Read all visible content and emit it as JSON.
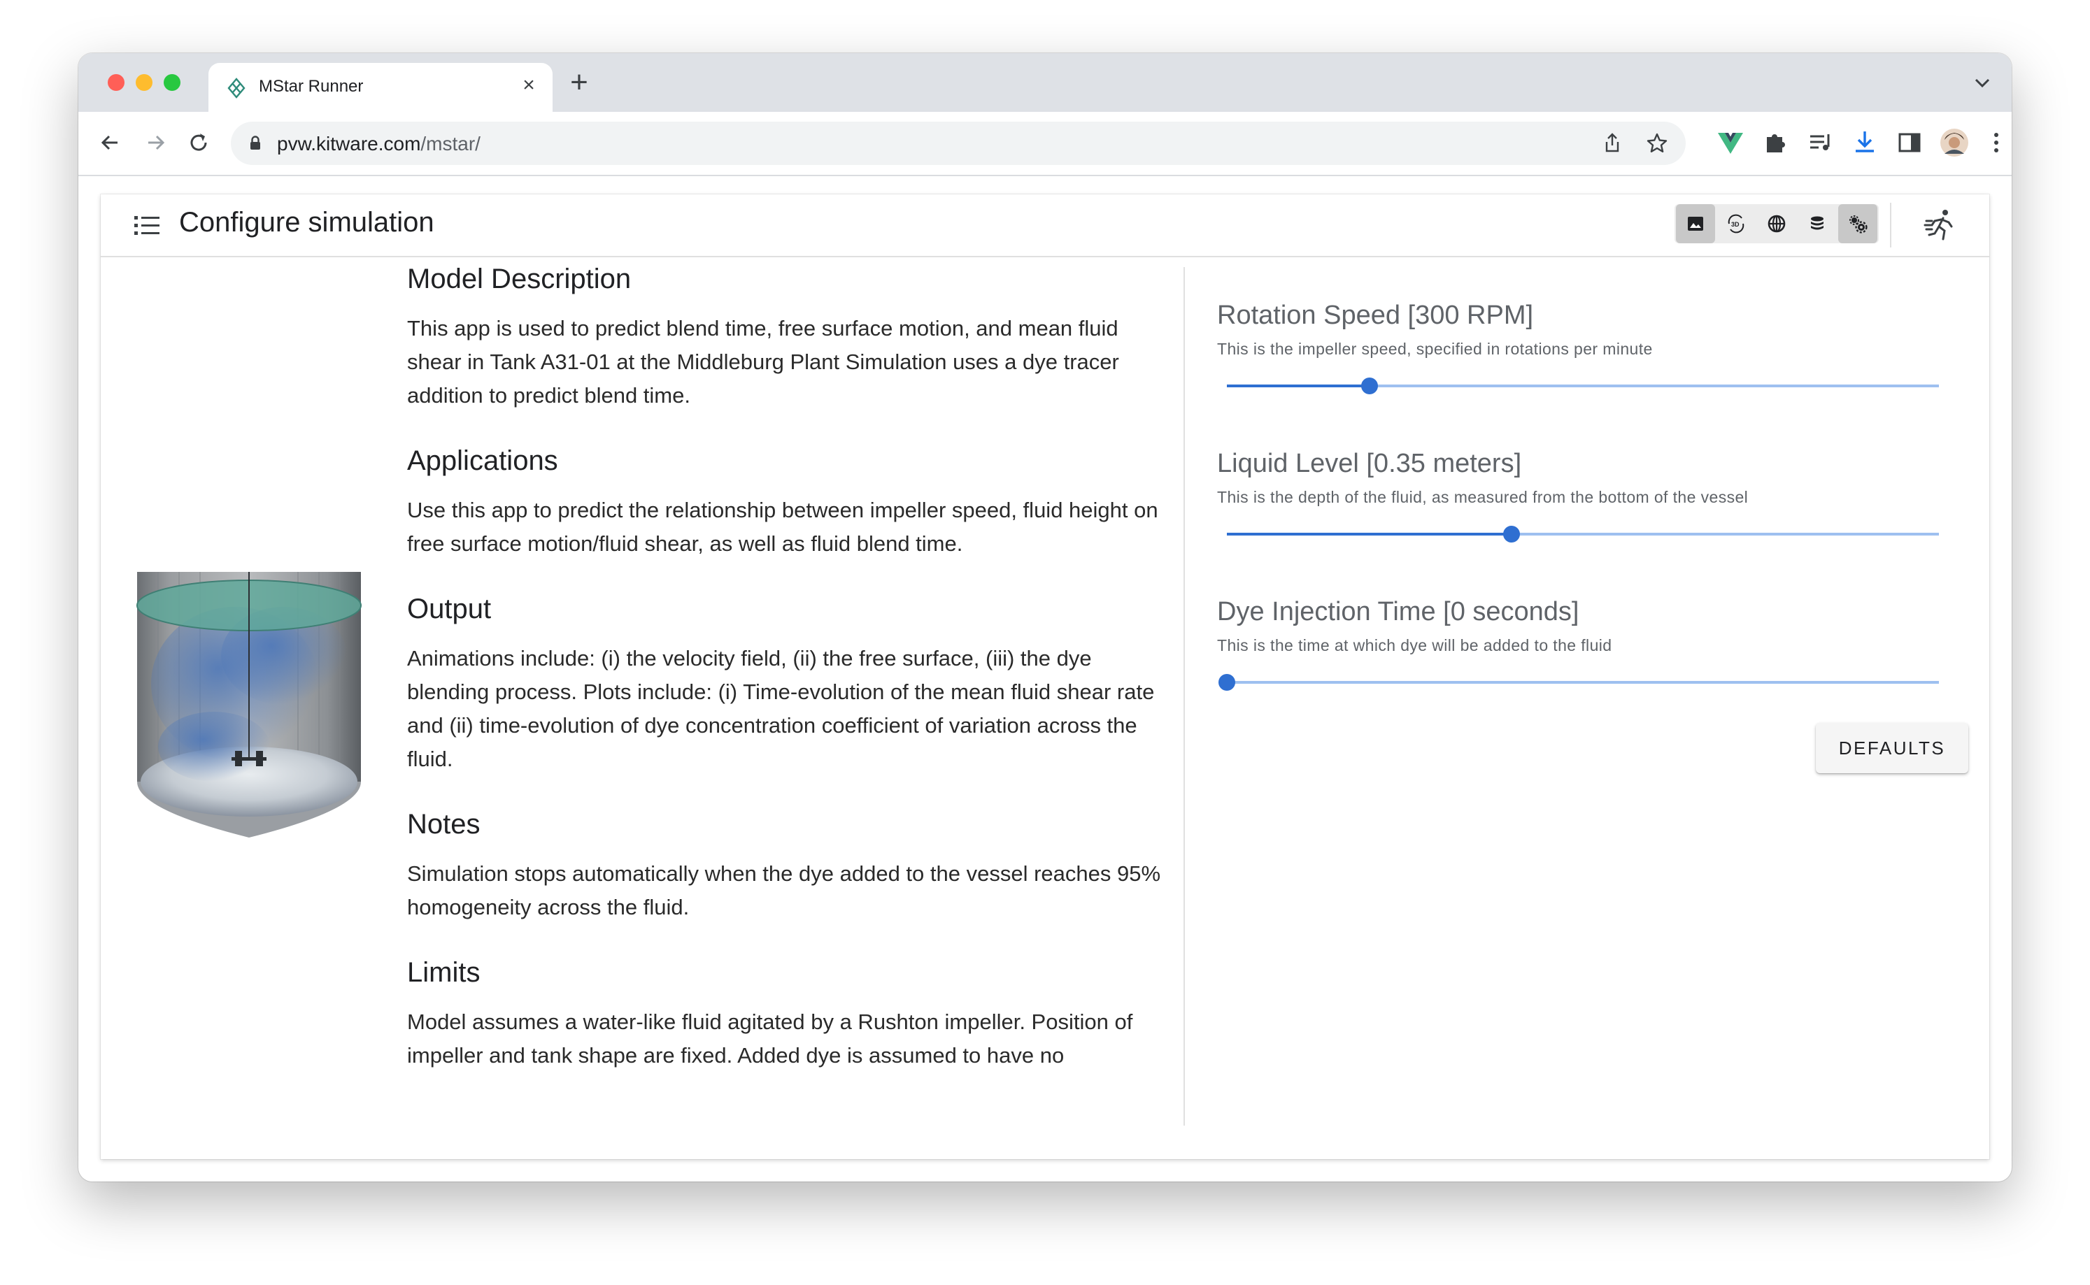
{
  "browser": {
    "tab_title": "MStar Runner",
    "tab_close_glyph": "×",
    "new_tab_glyph": "+",
    "url_domain": "pvw.kitware.com",
    "url_path": "/mstar/"
  },
  "icons": {
    "back": "arrow-left-icon",
    "forward": "arrow-right-icon",
    "reload": "reload-icon",
    "lock": "lock-icon",
    "share": "share-icon",
    "bookmark": "star-icon",
    "vue": "vue-extension-icon",
    "extensions": "puzzle-icon",
    "media": "media-queue-icon",
    "download": "download-icon",
    "sidepanel": "side-panel-icon",
    "profile": "avatar",
    "menu": "more-vert-icon"
  },
  "app": {
    "title": "Configure simulation",
    "view_buttons": [
      {
        "name": "image-view-button",
        "active": true
      },
      {
        "name": "3d-view-button",
        "active": false
      },
      {
        "name": "globe-view-button",
        "active": false
      },
      {
        "name": "database-view-button",
        "active": false
      },
      {
        "name": "settings-view-button",
        "active": true
      }
    ]
  },
  "description": {
    "sections": [
      {
        "heading": "Model Description",
        "text": "This app is used to predict blend time, free surface motion, and mean fluid shear in Tank A31-01 at the Middleburg Plant Simulation uses a dye tracer addition to predict blend time."
      },
      {
        "heading": "Applications",
        "text": "Use this app to predict the relationship between impeller speed, fluid height on free surface motion/fluid shear, as well as fluid blend time."
      },
      {
        "heading": "Output",
        "text": "Animations include: (i) the velocity field, (ii) the free surface, (iii) the dye blending process. Plots include: (i) Time-evolution of the mean fluid shear rate and (ii) time-evolution of dye concentration coefficient of variation across the fluid."
      },
      {
        "heading": "Notes",
        "text": "Simulation stops automatically when the dye added to the vessel reaches 95% homogeneity across the fluid."
      },
      {
        "heading": "Limits",
        "text": "Model assumes a water-like fluid agitated by a Rushton impeller. Position of impeller and tank shape are fixed. Added dye is assumed to have no"
      }
    ]
  },
  "params": [
    {
      "title": "Rotation Speed [300 RPM]",
      "subtitle": "This is the impeller speed, specified in rotations per minute",
      "fraction": 0.2
    },
    {
      "title": "Liquid Level [0.35 meters]",
      "subtitle": "This is the depth of the fluid, as measured from the bottom of the vessel",
      "fraction": 0.4
    },
    {
      "title": "Dye Injection Time [0 seconds]",
      "subtitle": "This is the time at which dye will be added to the fluid",
      "fraction": 0.0
    }
  ],
  "defaults_label": "DEFAULTS",
  "colors": {
    "accent": "#2f6fd1",
    "track": "#9ec0f0"
  }
}
